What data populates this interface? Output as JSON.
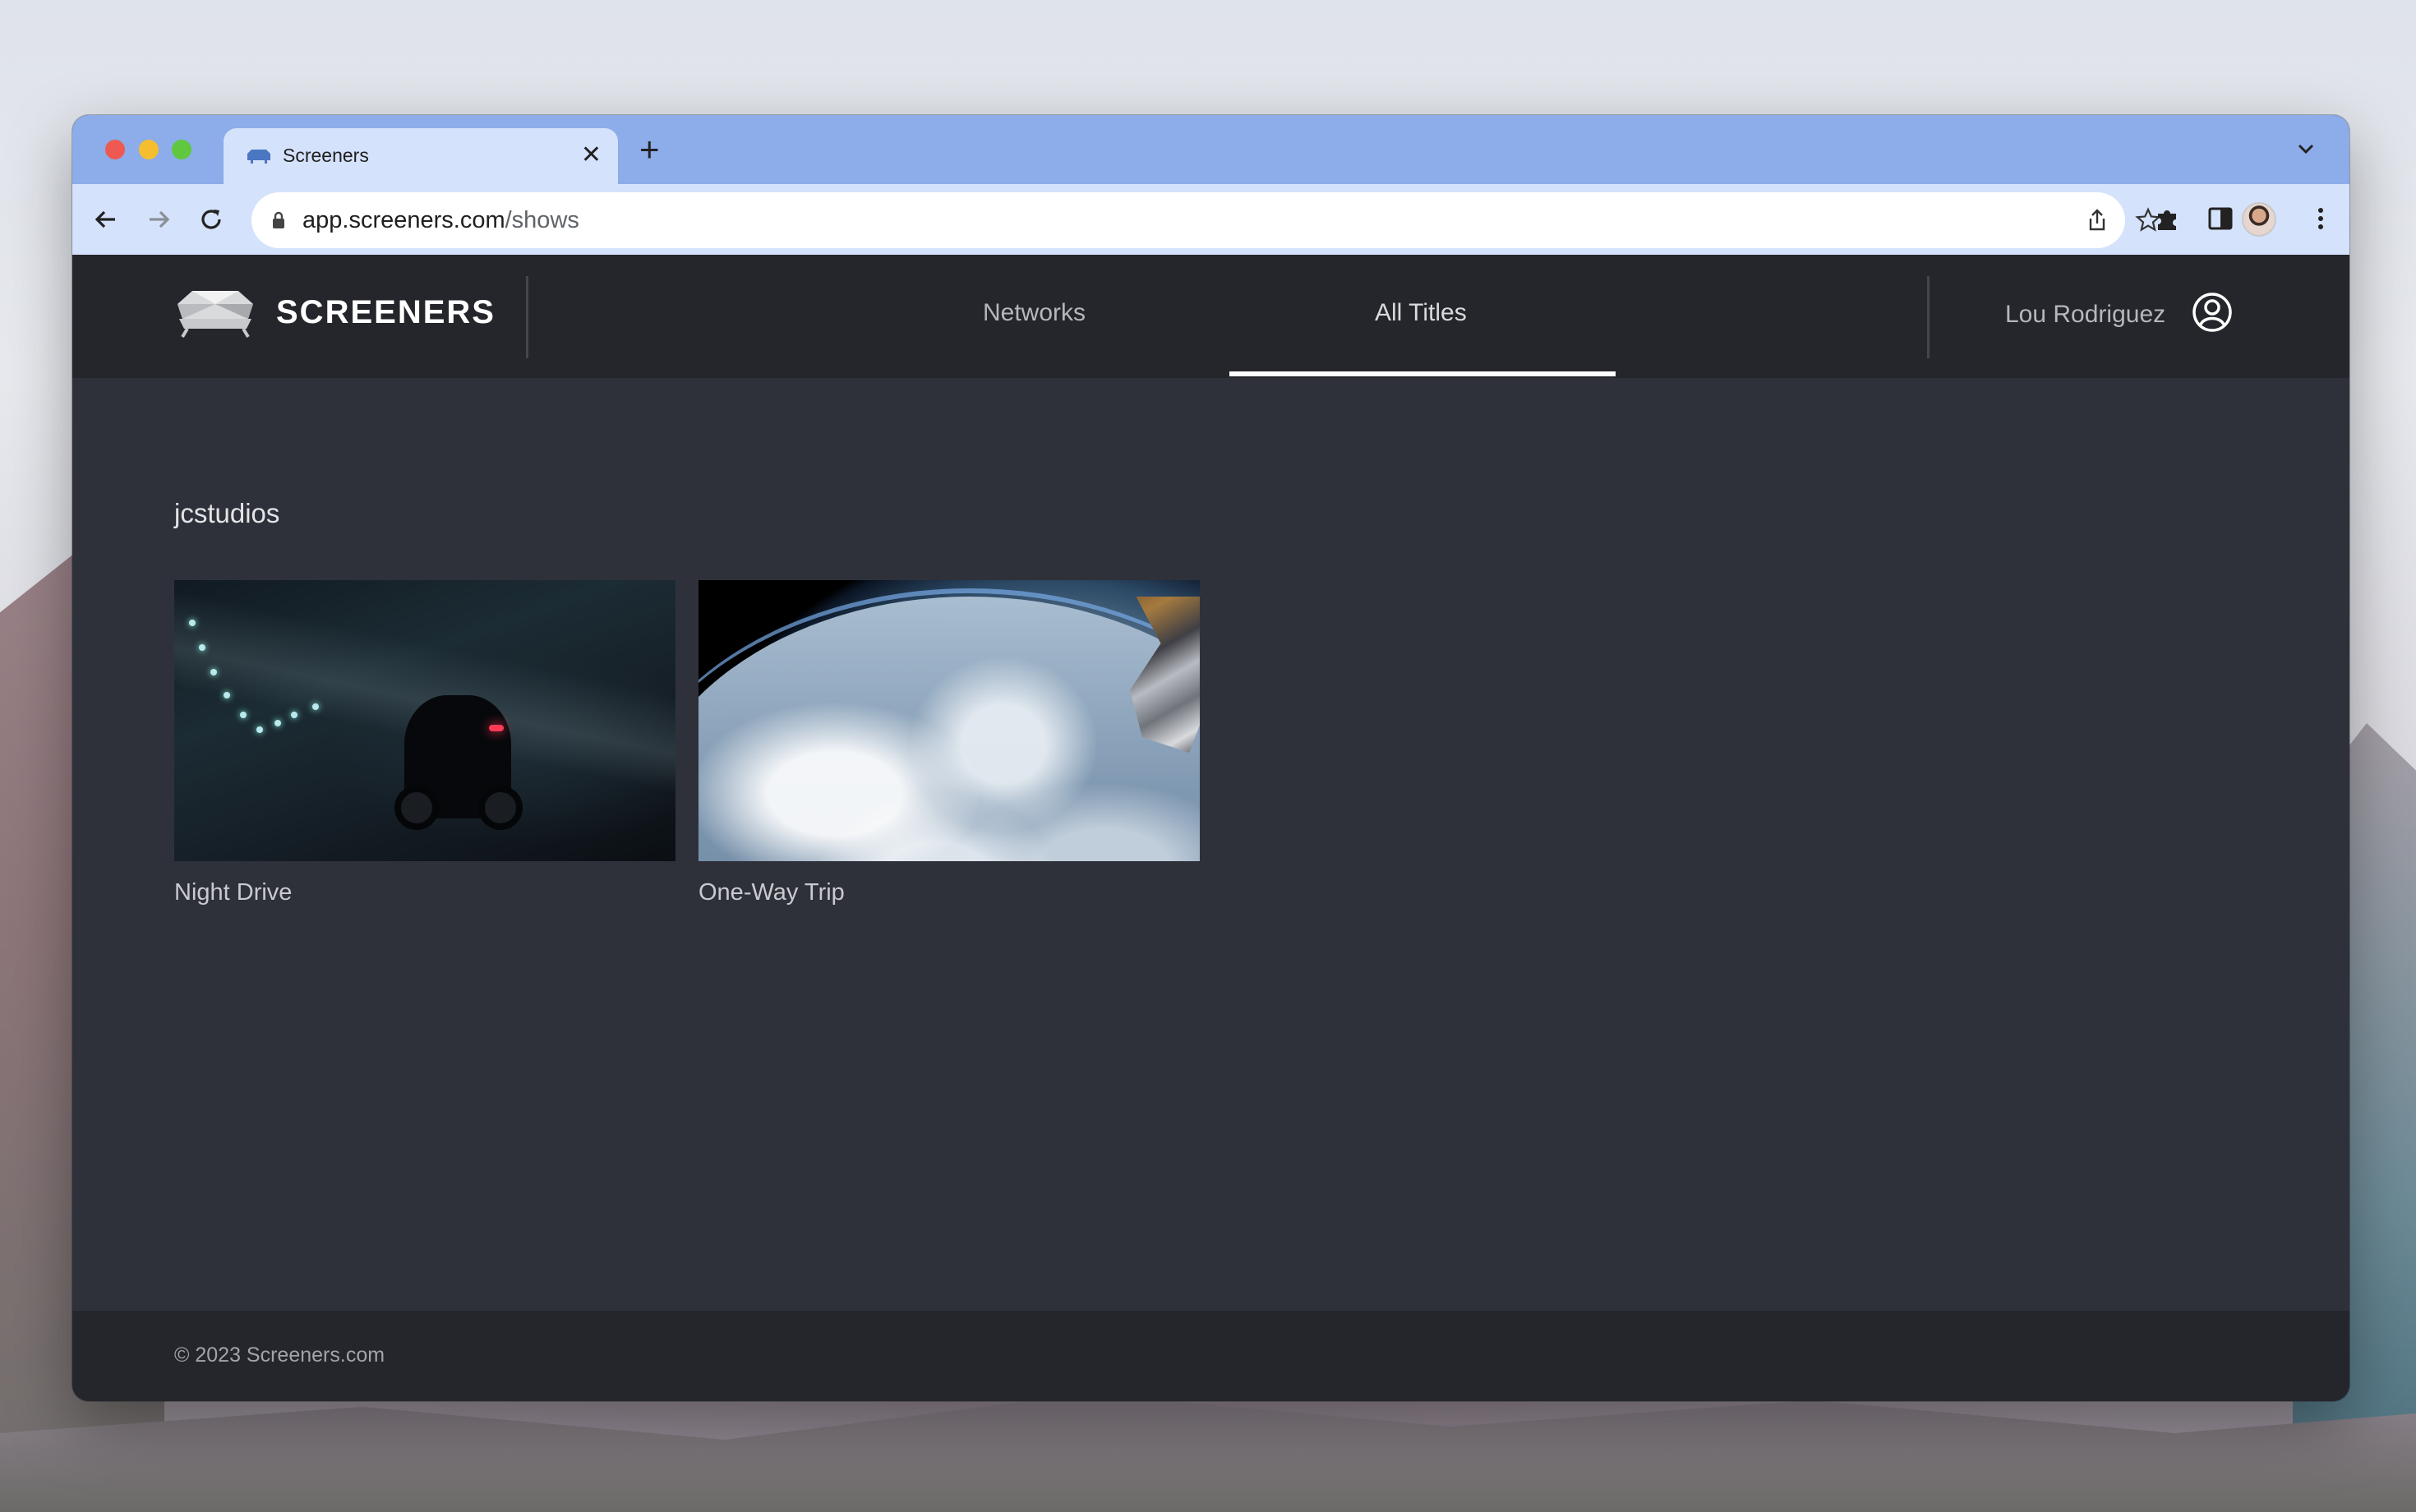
{
  "browser": {
    "tab_title": "Screeners",
    "url_host": "app.screeners.com",
    "url_path": "/shows"
  },
  "app": {
    "brand": "SCREENERS",
    "nav": [
      {
        "label": "Networks",
        "active": false
      },
      {
        "label": "All Titles",
        "active": true
      }
    ],
    "user_name": "Lou Rodriguez"
  },
  "main": {
    "section_title": "jcstudios",
    "titles": [
      {
        "name": "Night Drive",
        "thumbnail": "motorcycle-in-tunnel"
      },
      {
        "name": "One-Way Trip",
        "thumbnail": "earth-from-space-station"
      }
    ]
  },
  "footer": {
    "copyright": "© 2023 Screeners.com"
  },
  "colors": {
    "tab_strip": "#8cacea",
    "toolbar": "#d5e2fb",
    "app_header": "#25262c",
    "content_bg": "#2f313a",
    "active_underline": "#ffffff"
  }
}
